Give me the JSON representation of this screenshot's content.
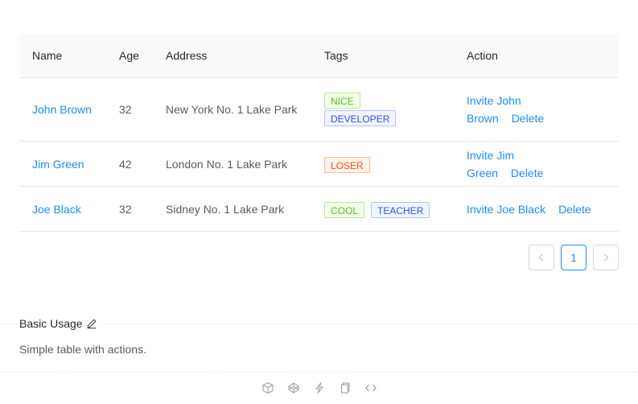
{
  "table": {
    "columns": [
      "Name",
      "Age",
      "Address",
      "Tags",
      "Action"
    ],
    "rows": [
      {
        "name": "John Brown",
        "age": "32",
        "address": "New York No. 1 Lake Park",
        "tags": [
          {
            "label": "NICE",
            "color": "green"
          },
          {
            "label": "DEVELOPER",
            "color": "geekblue"
          }
        ],
        "invite": "Invite John Brown",
        "delete": "Delete"
      },
      {
        "name": "Jim Green",
        "age": "42",
        "address": "London No. 1 Lake Park",
        "tags": [
          {
            "label": "LOSER",
            "color": "volcano"
          }
        ],
        "invite": "Invite Jim Green",
        "delete": "Delete"
      },
      {
        "name": "Joe Black",
        "age": "32",
        "address": "Sidney No. 1 Lake Park",
        "tags": [
          {
            "label": "COOL",
            "color": "green"
          },
          {
            "label": "TEACHER",
            "color": "geekblue"
          }
        ],
        "invite": "Invite Joe Black",
        "delete": "Delete"
      }
    ]
  },
  "pagination": {
    "prev": "‹",
    "current": "1",
    "next": "›"
  },
  "demo": {
    "title": "Basic Usage",
    "description": "Simple table with actions."
  },
  "colors": {
    "link": "#1890ff",
    "green": "#52c41a",
    "geekblue": "#2f54eb",
    "volcano": "#fa541c"
  },
  "toolbar_icons": [
    "codesandbox-icon",
    "codepen-icon",
    "thunderbolt-icon",
    "copy-icon",
    "code-icon"
  ]
}
